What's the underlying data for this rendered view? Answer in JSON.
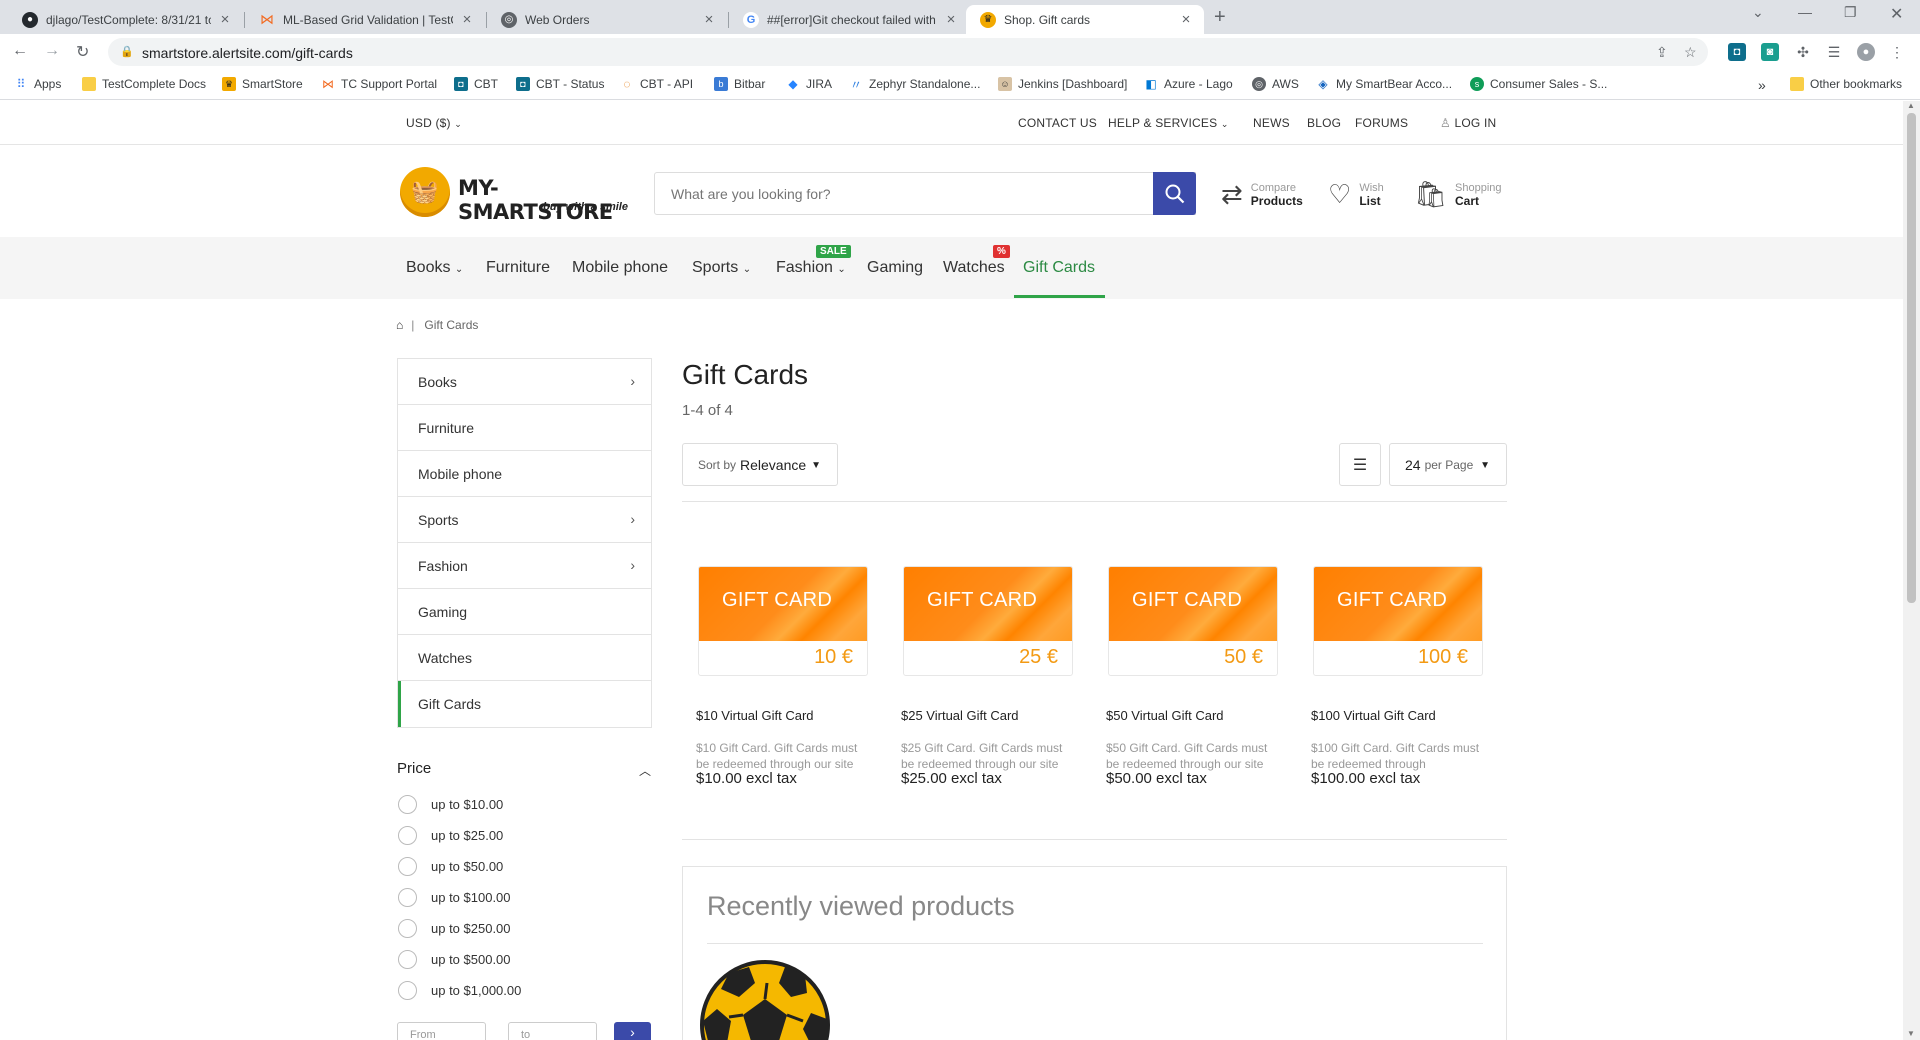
{
  "browser": {
    "tabs": [
      {
        "title": "djlago/TestComplete: 8/31/21 tc",
        "favicon": "github-icon"
      },
      {
        "title": "ML-Based Grid Validation | TestC",
        "favicon": "smartbear-icon"
      },
      {
        "title": "Web Orders",
        "favicon": "globe-icon"
      },
      {
        "title": "##[error]Git checkout failed with",
        "favicon": "google-icon"
      },
      {
        "title": "Shop. Gift cards",
        "favicon": "smartstore-icon"
      }
    ],
    "url": "smartstore.alertsite.com/gift-cards",
    "bookmarks": [
      {
        "label": "Apps"
      },
      {
        "label": "TestComplete Docs"
      },
      {
        "label": "SmartStore"
      },
      {
        "label": "TC Support Portal"
      },
      {
        "label": "CBT"
      },
      {
        "label": "CBT - Status"
      },
      {
        "label": "CBT - API"
      },
      {
        "label": "Bitbar"
      },
      {
        "label": "JIRA"
      },
      {
        "label": "Zephyr Standalone..."
      },
      {
        "label": "Jenkins [Dashboard]"
      },
      {
        "label": "Azure - Lago"
      },
      {
        "label": "AWS"
      },
      {
        "label": "My SmartBear Acco..."
      },
      {
        "label": "Consumer Sales - S..."
      }
    ],
    "bookmarks_overflow": "»",
    "other_bookmarks": "Other bookmarks"
  },
  "topnav": {
    "currency": "USD ($)",
    "contact": "CONTACT US",
    "help": "HELP & SERVICES",
    "news": "NEWS",
    "blog": "BLOG",
    "forums": "FORUMS",
    "login": "LOG IN"
  },
  "header": {
    "logo_text": "MY-SMARTSTORE",
    "logo_tagline": "buy with a smile",
    "search_placeholder": "What are you looking for?",
    "compare": {
      "line1": "Compare",
      "line2": "Products"
    },
    "wishlist": {
      "line1": "Wish",
      "line2": "List"
    },
    "cart": {
      "line1": "Shopping",
      "line2": "Cart"
    }
  },
  "categories": [
    {
      "label": "Books",
      "dropdown": true
    },
    {
      "label": "Furniture"
    },
    {
      "label": "Mobile phone"
    },
    {
      "label": "Sports",
      "dropdown": true
    },
    {
      "label": "Fashion",
      "dropdown": true,
      "badge": "SALE"
    },
    {
      "label": "Gaming"
    },
    {
      "label": "Watches",
      "badge": "%"
    },
    {
      "label": "Gift Cards",
      "active": true
    }
  ],
  "breadcrumb": {
    "current": "Gift Cards",
    "separator": "|"
  },
  "sidebar": {
    "items": [
      {
        "label": "Books",
        "chevron": true
      },
      {
        "label": "Furniture"
      },
      {
        "label": "Mobile phone"
      },
      {
        "label": "Sports",
        "chevron": true
      },
      {
        "label": "Fashion",
        "chevron": true
      },
      {
        "label": "Gaming"
      },
      {
        "label": "Watches"
      },
      {
        "label": "Gift Cards",
        "active": true
      }
    ],
    "price": {
      "title": "Price",
      "options": [
        "up to $10.00",
        "up to $25.00",
        "up to $50.00",
        "up to $100.00",
        "up to $250.00",
        "up to $500.00",
        "up to $1,000.00"
      ],
      "from_placeholder": "From",
      "to_placeholder": "to"
    }
  },
  "main": {
    "title": "Gift Cards",
    "count": "1-4 of 4",
    "sort_prefix": "Sort by",
    "sort_value": "Relevance",
    "per_page_value": "24",
    "per_page_suffix": "per Page",
    "products": [
      {
        "card_label": "GIFT CARD",
        "amount": "10 €",
        "name": "$10 Virtual Gift Card",
        "desc": "$10 Gift Card. Gift Cards must be redeemed through our site",
        "price": "$10.00 excl tax"
      },
      {
        "card_label": "GIFT CARD",
        "amount": "25 €",
        "name": "$25 Virtual Gift Card",
        "desc": "$25 Gift Card. Gift Cards must be redeemed through our site",
        "price": "$25.00 excl tax"
      },
      {
        "card_label": "GIFT CARD",
        "amount": "50 €",
        "name": "$50 Virtual Gift Card",
        "desc": "$50 Gift Card. Gift Cards must be redeemed through our site",
        "price": "$50.00 excl tax"
      },
      {
        "card_label": "GIFT CARD",
        "amount": "100 €",
        "name": "$100 Virtual Gift Card",
        "desc": "$100 Gift Card. Gift Cards must be redeemed through",
        "price": "$100.00 excl tax"
      }
    ],
    "recent_title": "Recently viewed products"
  },
  "colors": {
    "accent_green": "#2fa448",
    "brand_blue": "#3b4aa9",
    "gift_orange": "#ff8400",
    "sale_badge": "#2fa448",
    "percent_badge": "#e03131"
  }
}
